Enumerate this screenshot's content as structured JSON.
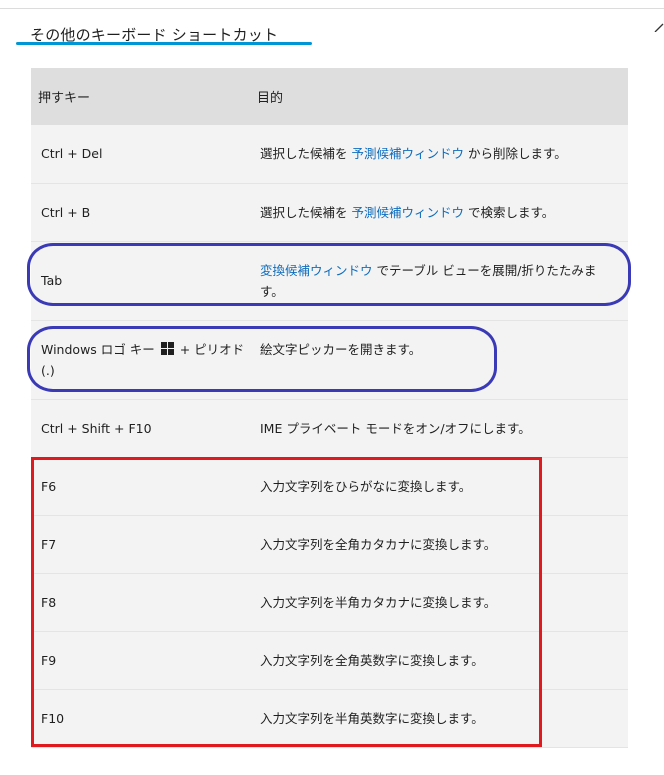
{
  "section": {
    "title": "その他のキーボード ショートカット"
  },
  "table": {
    "headers": {
      "key": "押すキー",
      "purpose": "目的"
    },
    "rows": [
      {
        "key": "Ctrl + Del",
        "purpose_before": "選択した候補を ",
        "purpose_link": "予測候補ウィンドウ",
        "purpose_after": " から削除します。"
      },
      {
        "key": "Ctrl + B",
        "purpose_before": "選択した候補を ",
        "purpose_link": "予測候補ウィンドウ",
        "purpose_after": " で検索します。"
      },
      {
        "key": "Tab",
        "purpose_link": "変換候補ウィンドウ",
        "purpose_after": " でテーブル ビューを展開/折りたたみます。"
      },
      {
        "key_before": "Windows ロゴ キー ",
        "key_icon": "windows-logo-icon",
        "key_after": " + ピリオド (.)",
        "purpose": "絵文字ピッカーを開きます。"
      },
      {
        "key": "Ctrl + Shift + F10",
        "purpose": "IME プライベート モードをオン/オフにします。"
      },
      {
        "key": "F6",
        "purpose": "入力文字列をひらがなに変換します。"
      },
      {
        "key": "F7",
        "purpose": "入力文字列を全角カタカナに変換します。"
      },
      {
        "key": "F8",
        "purpose": "入力文字列を半角カタカナに変換します。"
      },
      {
        "key": "F9",
        "purpose": "入力文字列を全角英数字に変換します。"
      },
      {
        "key": "F10",
        "purpose": "入力文字列を半角英数字に変換します。"
      }
    ]
  },
  "colors": {
    "accent_underline": "#0096d6",
    "link": "#0f6cbd",
    "annotation_blue": "#3a3ab6",
    "annotation_red": "#e0191f",
    "header_bg": "#dedede",
    "row_bg": "#f3f3f3"
  }
}
